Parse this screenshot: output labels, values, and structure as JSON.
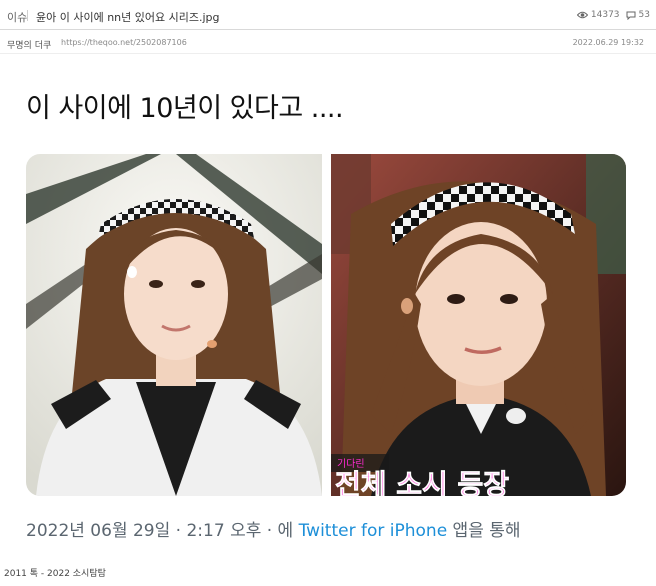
{
  "post": {
    "category": "이슈",
    "title": "윤아 이 사이에 nn년 있어요 시리즈.jpg",
    "views": "14373",
    "comments": "53",
    "author": "무명의 더쿠",
    "url": "https://theqoo.net/2502087106",
    "date": "2022.06.29 19:32"
  },
  "tweet": {
    "text": "이 사이에 10년이 있다고 ....",
    "timestamp_date": "2022년 06월 29일",
    "timestamp_sep": " · ",
    "timestamp_time": "2:17 오후",
    "via_prefix": " · 에 ",
    "via_link": "Twitter for iPhone",
    "via_suffix": " 앱을 통해"
  },
  "images": {
    "left_alt": "headband-photo-2011",
    "right_alt": "headband-photo-2022",
    "right_caption_small": "기다린",
    "right_caption_big": "전체 소시 등장"
  },
  "footer": {
    "text": "2011 톡 - 2022 소시탐탐"
  },
  "colors": {
    "link": "#1d8fd8",
    "caption_magenta": "#ff2ad0"
  }
}
